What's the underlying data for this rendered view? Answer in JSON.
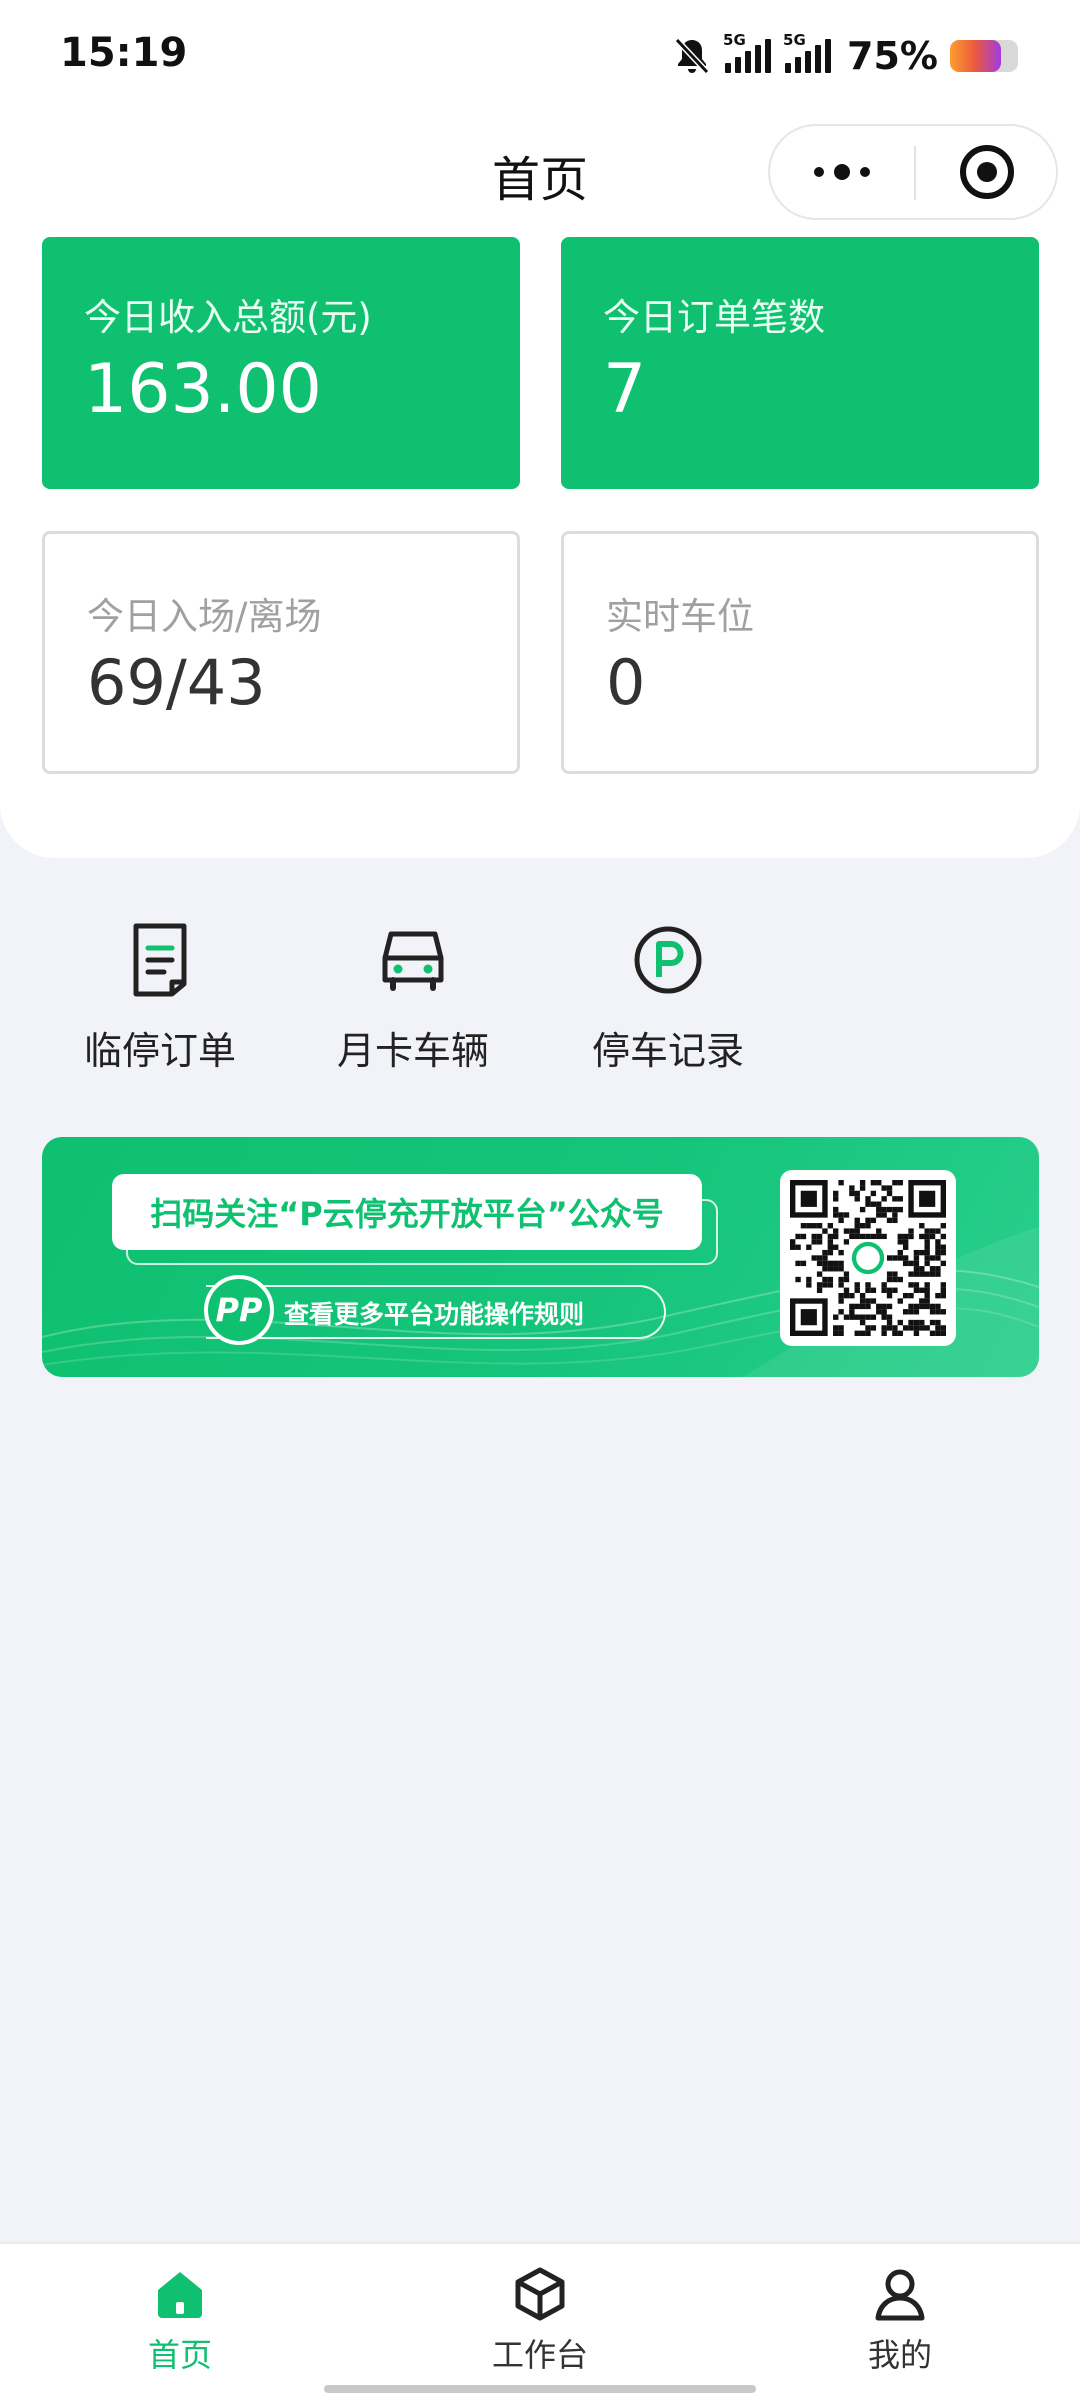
{
  "status_bar": {
    "time": "15:19",
    "network_1": "5G",
    "network_2": "5G",
    "battery_percent": "75%",
    "battery_level": 0.75
  },
  "nav": {
    "title": "首页"
  },
  "stats": {
    "income": {
      "label": "今日收入总额(元)",
      "value": "163.00"
    },
    "orders": {
      "label": "今日订单笔数",
      "value": "7"
    },
    "entries": {
      "label": "今日入场/离场",
      "value": "69/43"
    },
    "spaces": {
      "label": "实时车位",
      "value": "0"
    }
  },
  "shortcuts": [
    {
      "label": "临停订单",
      "icon": "document-icon"
    },
    {
      "label": "月卡车辆",
      "icon": "car-icon"
    },
    {
      "label": "停车记录",
      "icon": "parking-icon"
    }
  ],
  "banner": {
    "headline": "扫码关注“P云停充开放平台”公众号",
    "subline": "查看更多平台功能操作规则",
    "logo_text": "PP"
  },
  "tabbar": [
    {
      "label": "首页",
      "icon": "home-icon",
      "active": true
    },
    {
      "label": "工作台",
      "icon": "cube-icon",
      "active": false
    },
    {
      "label": "我的",
      "icon": "user-icon",
      "active": false
    }
  ],
  "colors": {
    "brand": "#0ec06f",
    "text": "#222222",
    "muted": "#a0a0a0",
    "background": "#f2f3f8"
  }
}
